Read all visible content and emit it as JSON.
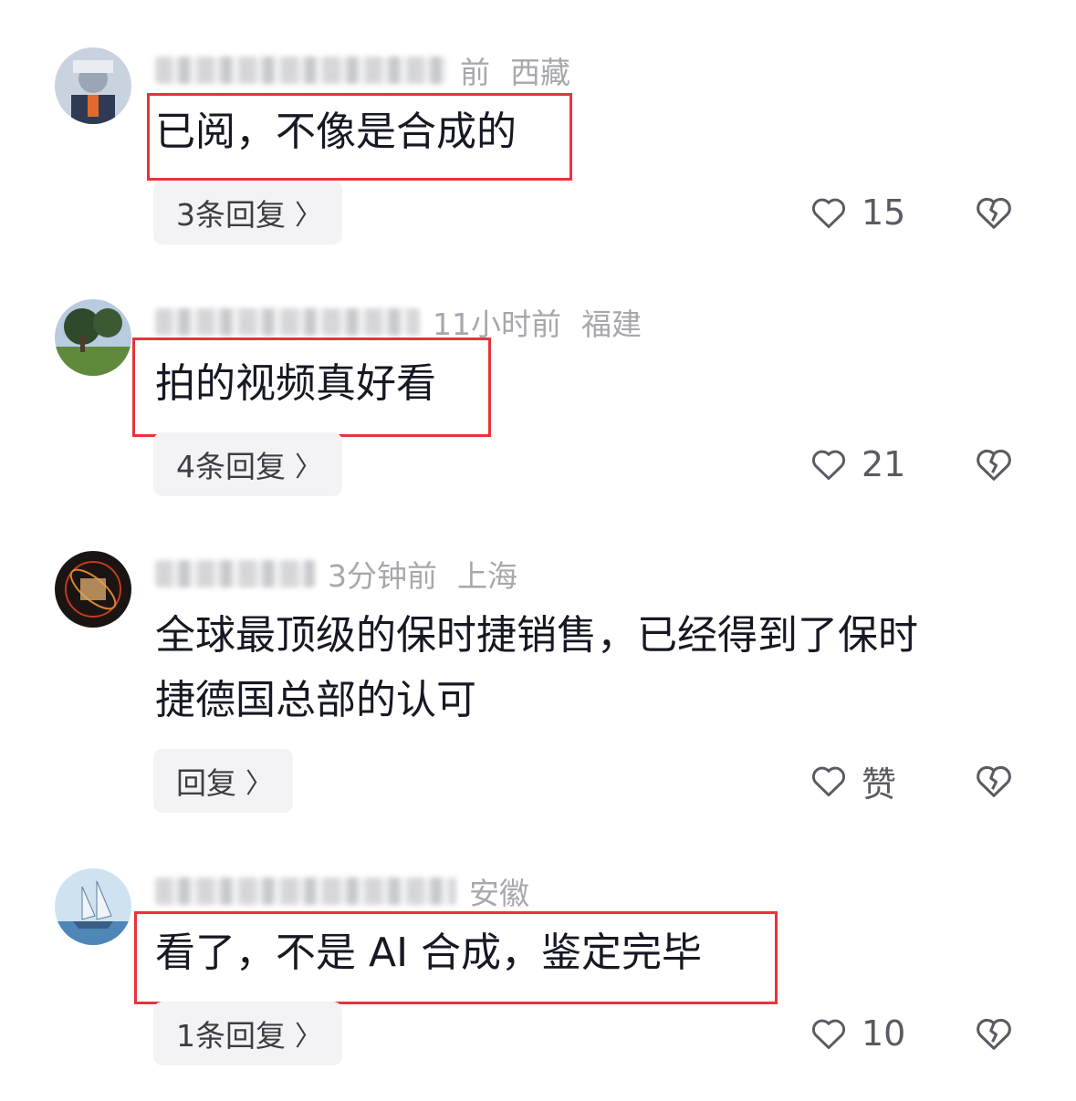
{
  "comments": [
    {
      "time": "前",
      "location": "西藏",
      "text": "已阅，不像是合成的",
      "reply_label": "3条回复",
      "likes": "15"
    },
    {
      "time": "11小时前",
      "location": "福建",
      "text": "拍的视频真好看",
      "reply_label": "4条回复",
      "likes": "21"
    },
    {
      "time": "3分钟前",
      "location": "上海",
      "text_line1": "全球最顶级的保时捷销售，已经得到了保时",
      "text_line2": "捷德国总部的认可",
      "reply_label": "回复",
      "likes": "赞"
    },
    {
      "location": "安徽",
      "text": "看了，不是 AI 合成，鉴定完毕",
      "reply_label": "1条回复",
      "likes": "10"
    }
  ],
  "icons": {
    "like": "heart-outline-icon",
    "dislike": "broken-heart-icon",
    "chevron": "chevron-right-icon"
  },
  "colors": {
    "highlight": "#e8333a",
    "meta": "#a7a8ad",
    "text": "#161823"
  }
}
